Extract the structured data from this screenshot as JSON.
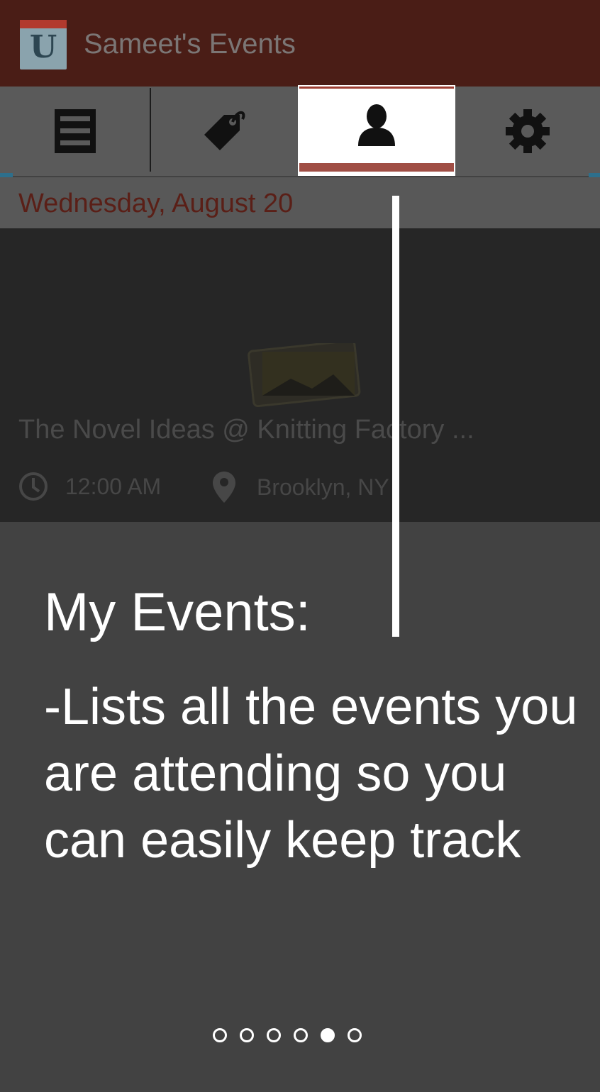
{
  "app": {
    "title": "Sameet's Events",
    "logo_letter": "U"
  },
  "tabs": [
    {
      "icon": "menu-icon",
      "active": false
    },
    {
      "icon": "tag-icon",
      "active": false
    },
    {
      "icon": "user-icon",
      "active": true
    },
    {
      "icon": "gear-icon",
      "active": false
    }
  ],
  "date_header": "Wednesday, August 20",
  "event": {
    "title": "The Novel Ideas @ Knitting Factory ...",
    "time": "12:00 AM",
    "location": "Brooklyn, NY"
  },
  "tutorial": {
    "heading": "My Events:",
    "description": "-Lists all the events you are attending so you can easily keep track"
  },
  "pagination": {
    "total": 6,
    "current": 5
  },
  "colors": {
    "titlebar": "#4a1d16",
    "overlay": "#424242",
    "accent": "#a04e45"
  }
}
